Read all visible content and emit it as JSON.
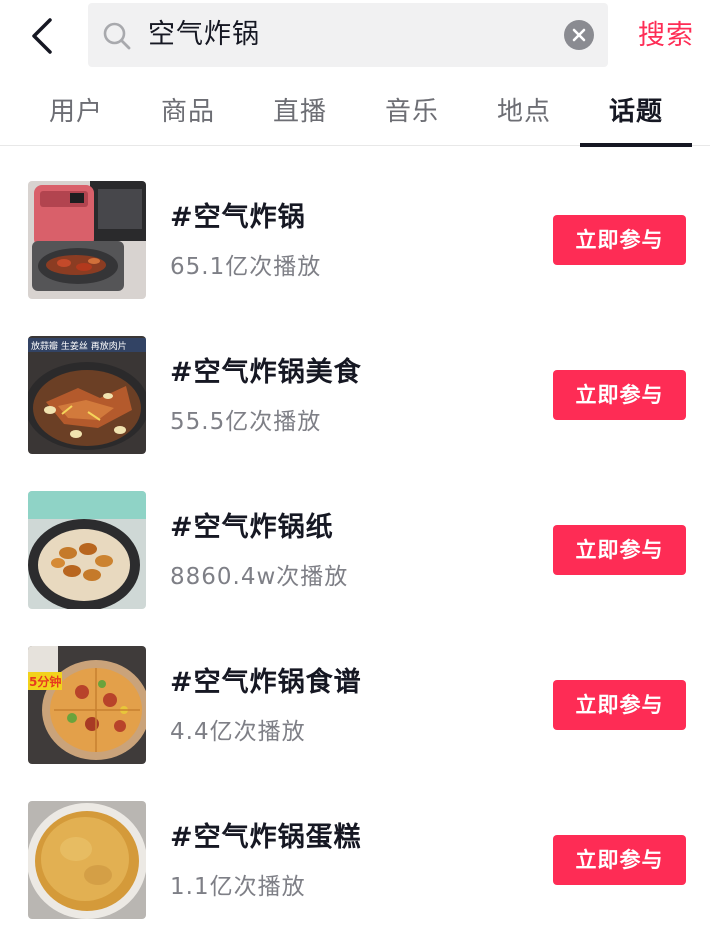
{
  "search": {
    "query": "空气炸锅",
    "submit_label": "搜索"
  },
  "tabs": [
    {
      "label": "用户"
    },
    {
      "label": "商品"
    },
    {
      "label": "直播"
    },
    {
      "label": "音乐"
    },
    {
      "label": "地点"
    },
    {
      "label": "话题"
    }
  ],
  "active_tab": "话题",
  "topics": [
    {
      "title": "#空气炸锅",
      "plays": "65.1亿次播放",
      "action": "立即参与",
      "thumb_text": ""
    },
    {
      "title": "#空气炸锅美食",
      "plays": "55.5亿次播放",
      "action": "立即参与",
      "thumb_text": "放蒜瓣 生姜丝 再放肉片"
    },
    {
      "title": "#空气炸锅纸",
      "plays": "8860.4w次播放",
      "action": "立即参与",
      "thumb_text": ""
    },
    {
      "title": "#空气炸锅食谱",
      "plays": "4.4亿次播放",
      "action": "立即参与",
      "thumb_text": "5分钟"
    },
    {
      "title": "#空气炸锅蛋糕",
      "plays": "1.1亿次播放",
      "action": "立即参与",
      "thumb_text": ""
    }
  ],
  "colors": {
    "accent": "#fe2c55",
    "text_primary": "#161823",
    "text_secondary": "#7e7f86",
    "search_bg": "#f1f1f2"
  },
  "icons": {
    "back": "chevron-left-icon",
    "search": "search-icon",
    "clear": "close-circle-icon"
  }
}
